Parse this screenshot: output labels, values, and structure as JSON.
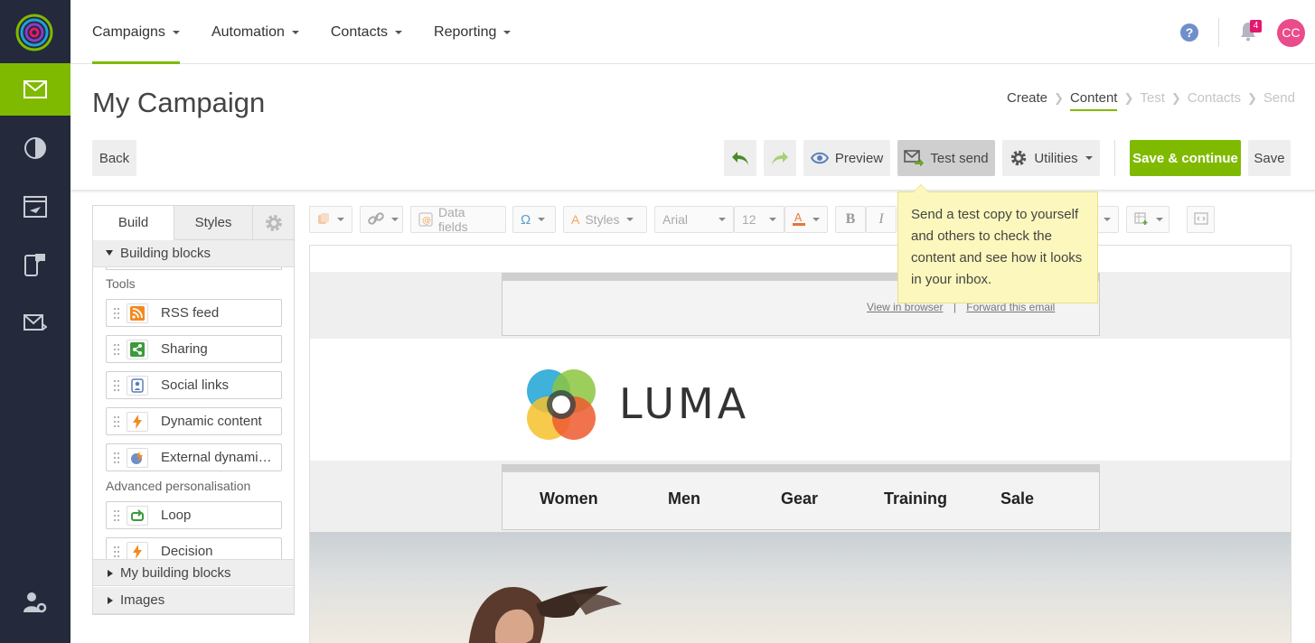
{
  "nav": {
    "menu": [
      {
        "label": "Campaigns"
      },
      {
        "label": "Automation"
      },
      {
        "label": "Contacts"
      },
      {
        "label": "Reporting"
      }
    ],
    "notification_count": "4",
    "avatar_initials": "CC",
    "help": "?"
  },
  "page": {
    "title": "My Campaign"
  },
  "steps": [
    {
      "label": "Create"
    },
    {
      "label": "Content"
    },
    {
      "label": "Test"
    },
    {
      "label": "Contacts"
    },
    {
      "label": "Send"
    }
  ],
  "toolbar": {
    "back": "Back",
    "preview": "Preview",
    "test_send": "Test send",
    "utilities": "Utilities",
    "save_continue": "Save & continue",
    "save": "Save"
  },
  "tooltip": {
    "text": "Send a test copy to yourself and others to check the content and see how it looks in your inbox."
  },
  "panel": {
    "tabs": {
      "build": "Build",
      "styles": "Styles"
    },
    "building_blocks": "Building blocks",
    "tools_label": "Tools",
    "tools": [
      {
        "label": "RSS feed"
      },
      {
        "label": "Sharing"
      },
      {
        "label": "Social links"
      },
      {
        "label": "Dynamic content"
      },
      {
        "label": "External dynamic content"
      }
    ],
    "advanced_label": "Advanced personalisation",
    "advanced": [
      {
        "label": "Loop"
      },
      {
        "label": "Decision"
      }
    ],
    "my_blocks": "My building blocks",
    "images": "Images"
  },
  "editor": {
    "data_fields": "Data fields",
    "styles": "Styles",
    "font": "Arial",
    "size": "12",
    "omega": "Ω",
    "bold": "B",
    "italic": "I"
  },
  "email": {
    "view_in_browser": "View in browser",
    "separator": "|",
    "forward": "Forward this email",
    "brand": "LUMA",
    "nav": [
      "Women",
      "Men",
      "Gear",
      "Training",
      "Sale"
    ]
  },
  "colors": {
    "accent": "#7fba00",
    "rail": "#242a3b",
    "tooltip": "#fcf8bd",
    "badge": "#e3186d",
    "avatar": "#ea4b8b"
  }
}
